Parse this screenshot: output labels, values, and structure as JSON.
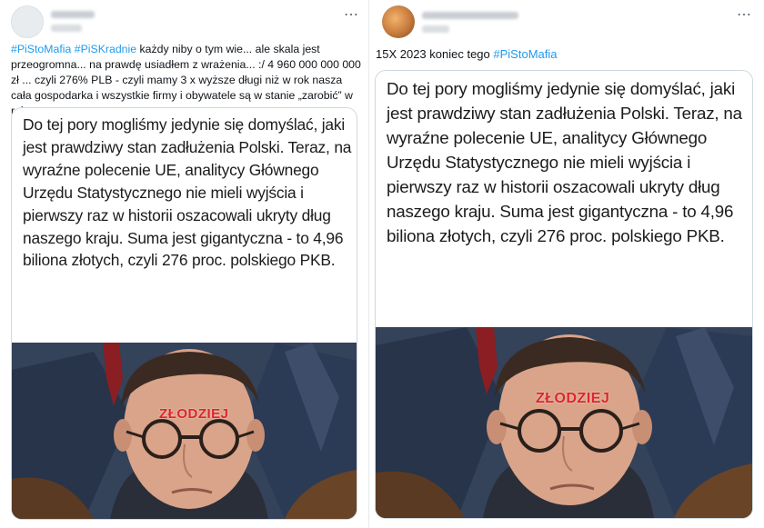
{
  "left_tweet": {
    "text": {
      "hashtag_1": "#PiStoMafia",
      "hashtag_2": "#PiSKradnie",
      "body": " każdy niby o tym wie... ale skala jest przeogromna... na prawdę usiadłem z wrażenia... :/ 4 960 000 000 000 zł ... czyli 276% PLB - czyli mamy 3 x wyższe długi niż w rok nasza cała gospodarka i wszystkie firmy i obywatele są w stanie „zarobić” w rok..."
    },
    "quote": "Do tej pory mogliśmy jedynie się domyślać, jaki jest prawdziwy stan zadłużenia Polski. Teraz, na wyraźne polecenie UE, analitycy Głównego Urzędu Statystycznego nie mieli wyjścia i pierwszy raz w historii oszacowali ukryty dług naszego kraju. Suma jest gigantyczna - to 4,96 biliona złotych, czyli 276 proc. polskiego PKB.",
    "stamp": "ZŁODZIEJ",
    "more_icon": "more-horizontal-icon"
  },
  "right_tweet": {
    "text": {
      "body": "15X 2023 koniec tego ",
      "hashtag": "#PiStoMafia"
    },
    "quote": "Do tej pory mogliśmy jedynie się domyślać, jaki jest prawdziwy stan zadłużenia Polski. Teraz, na wyraźne polecenie UE, analitycy Głównego Urzędu Statystycznego nie mieli wyjścia i pierwszy raz w historii oszacowali ukryty dług naszego kraju. Suma jest gigantyczna - to 4,96 biliona złotych, czyli 276 proc. polskiego PKB.",
    "stamp": "ZŁODZIEJ",
    "more_icon": "more-horizontal-icon"
  },
  "colors": {
    "hashtag": "#1d9bf0",
    "stamp": "#e0242b",
    "border": "#cfd9de"
  }
}
